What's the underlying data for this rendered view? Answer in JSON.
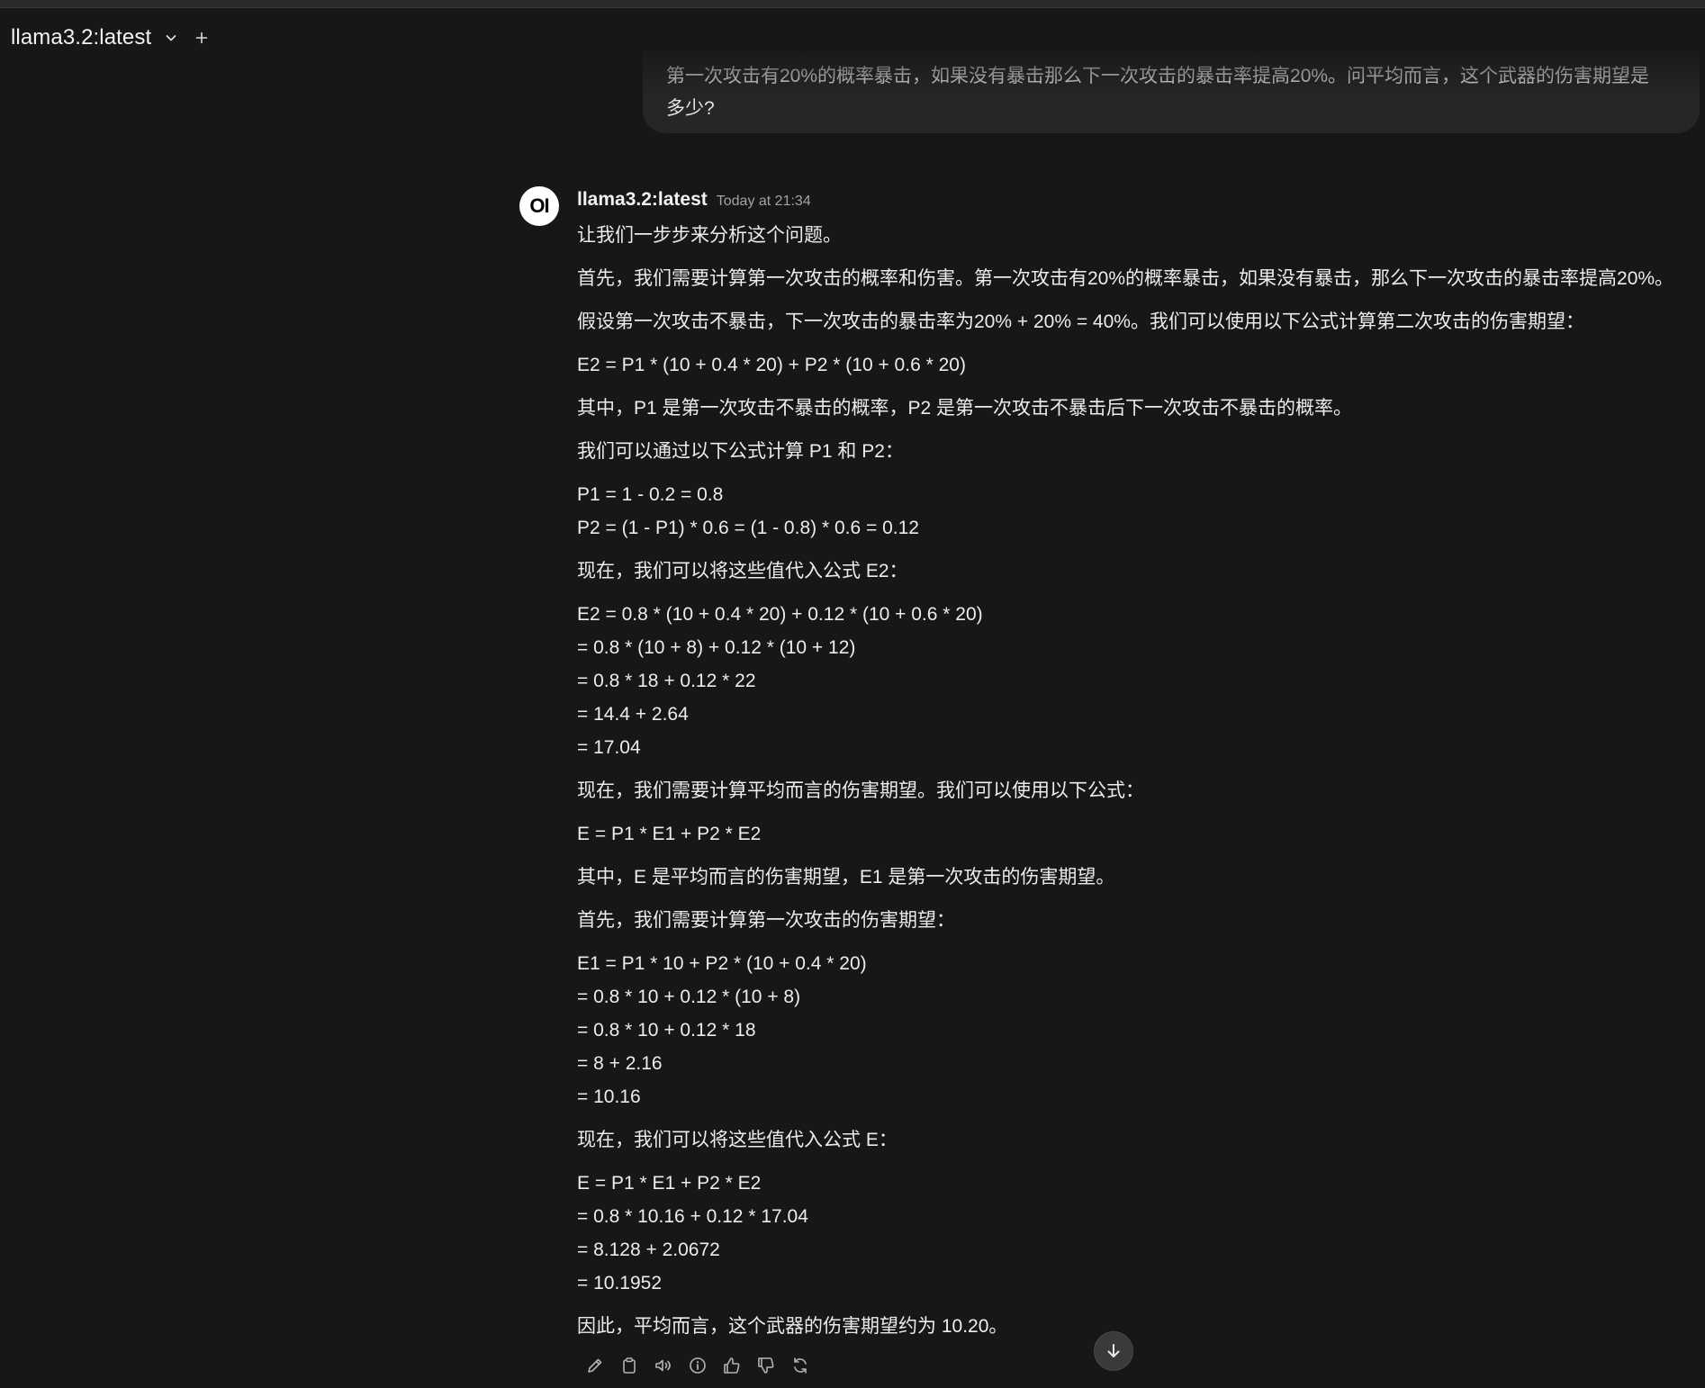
{
  "header": {
    "model": "llama3.2:latest",
    "dropdown_icon": "chevron-down-icon",
    "new_icon": "plus-icon"
  },
  "user_message": {
    "line1": "第一次攻击有20%的概率暴击，如果没有暴击那么下一次攻击的暴击率提高20%。问平均而言，这个武器的伤害期望是",
    "line2": "多少?"
  },
  "assistant": {
    "avatar": "OI",
    "name": "llama3.2:latest",
    "time": "Today at 21:34",
    "lines": [
      "让我们一步步来分析这个问题。",
      "首先，我们需要计算第一次攻击的概率和伤害。第一次攻击有20%的概率暴击，如果没有暴击，那么下一次攻击的暴击率提高20%。",
      "假设第一次攻击不暴击，下一次攻击的暴击率为20% + 20% = 40%。我们可以使用以下公式计算第二次攻击的伤害期望：",
      "E2 = P1 * (10 + 0.4 * 20) + P2 * (10 + 0.6 * 20)",
      "其中，P1 是第一次攻击不暴击的概率，P2 是第一次攻击不暴击后下一次攻击不暴击的概率。",
      "我们可以通过以下公式计算 P1 和 P2：",
      "P1 = 1 - 0.2 = 0.8",
      "P2 = (1 - P1) * 0.6 = (1 - 0.8) * 0.6 = 0.12",
      "现在，我们可以将这些值代入公式 E2：",
      "E2 = 0.8 * (10 + 0.4 * 20) + 0.12 * (10 + 0.6 * 20)",
      "= 0.8 * (10 + 8) + 0.12 * (10 + 12)",
      "= 0.8 * 18 + 0.12 * 22",
      "= 14.4 + 2.64",
      "= 17.04",
      "现在，我们需要计算平均而言的伤害期望。我们可以使用以下公式：",
      "E = P1 * E1 + P2 * E2",
      "其中，E 是平均而言的伤害期望，E1 是第一次攻击的伤害期望。",
      "首先，我们需要计算第一次攻击的伤害期望：",
      "E1 = P1 * 10 + P2 * (10 + 0.4 * 20)",
      "= 0.8 * 10 + 0.12 * (10 + 8)",
      "= 0.8 * 10 + 0.12 * 18",
      "= 8 + 2.16",
      "= 10.16",
      "现在，我们可以将这些值代入公式 E：",
      "E = P1 * E1 + P2 * E2",
      "= 0.8 * 10.16 + 0.12 * 17.04",
      "= 8.128 + 2.0672",
      "= 10.1952",
      "因此，平均而言，这个武器的伤害期望约为 10.20。"
    ]
  },
  "actions": [
    "edit-icon",
    "copy-icon",
    "speaker-icon",
    "info-icon",
    "thumbs-up-icon",
    "thumbs-down-icon",
    "regenerate-icon"
  ],
  "scroll_icon": "arrow-down-icon"
}
